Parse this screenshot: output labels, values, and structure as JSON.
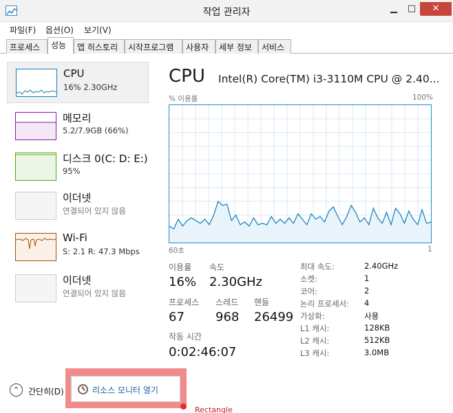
{
  "window": {
    "title": "작업 관리자",
    "minimize": "▁",
    "maximize": "□",
    "close": "✕"
  },
  "menu": [
    "파일(F)",
    "옵션(O)",
    "보기(V)"
  ],
  "tabs": [
    "프로세스",
    "성능",
    "앱 히스토리",
    "시작프로그램",
    "사용자",
    "세부 정보",
    "서비스"
  ],
  "active_tab": "성능",
  "resources": [
    {
      "title": "CPU",
      "sub": "16% 2.30GHz",
      "color": "#117dbb",
      "selected": true
    },
    {
      "title": "메모리",
      "sub": "5.2/7.9GB (66%)",
      "color": "#8b12ae",
      "selected": false
    },
    {
      "title": "디스크 0(C: D: E:)",
      "sub": "95%",
      "color": "#4da60c",
      "selected": false
    },
    {
      "title": "이더넷",
      "sub": "연결되어 있지 않음",
      "color": "#cccccc",
      "selected": false
    },
    {
      "title": "Wi-Fi",
      "sub": "S: 2.1 R: 47.3 Mbps",
      "color": "#a74f01",
      "selected": false
    },
    {
      "title": "이더넷",
      "sub": "연결되어 있지 않음",
      "color": "#cccccc",
      "selected": false
    }
  ],
  "cpu": {
    "title": "CPU",
    "model": "Intel(R) Core(TM) i3-3110M CPU @ 2.40...",
    "graph_top_left": "% 이용률",
    "graph_top_right": "100%",
    "graph_bottom_left": "60초",
    "graph_bottom_right": "1",
    "stats": {
      "utilization_label": "이용률",
      "utilization": "16%",
      "speed_label": "속도",
      "speed": "2.30GHz",
      "processes_label": "프로세스",
      "processes": "67",
      "threads_label": "스레드",
      "threads": "968",
      "handles_label": "핸들",
      "handles": "26499",
      "uptime_label": "작동 시간",
      "uptime": "0:02:46:07"
    },
    "specs": [
      {
        "label": "최대 속도:",
        "value": "2.40GHz"
      },
      {
        "label": "소켓:",
        "value": "1"
      },
      {
        "label": "코어:",
        "value": "2"
      },
      {
        "label": "논리 프로세서:",
        "value": "4"
      },
      {
        "label": "가상화:",
        "value": "사용"
      },
      {
        "label": "L1 캐시:",
        "value": "128KB"
      },
      {
        "label": "L2 캐시:",
        "value": "512KB"
      },
      {
        "label": "L3 캐시:",
        "value": "3.0MB"
      }
    ],
    "history_percent": [
      12,
      10,
      17,
      12,
      16,
      18,
      16,
      14,
      17,
      13,
      20,
      30,
      27,
      28,
      16,
      20,
      13,
      15,
      12,
      18,
      13,
      14,
      13,
      19,
      14,
      17,
      14,
      18,
      14,
      21,
      17,
      13,
      21,
      17,
      19,
      15,
      23,
      26,
      19,
      13,
      19,
      27,
      22,
      15,
      18,
      13,
      25,
      18,
      14,
      22,
      13,
      25,
      21,
      14,
      23,
      17,
      13,
      24,
      14,
      15
    ],
    "line_color": "#117dbb"
  },
  "footer": {
    "collapse_label": "간단히(D)",
    "collapse_icon": "⌃",
    "monitor_link": "리소스 모니터 열기",
    "annotation_label": "Rectangle"
  }
}
